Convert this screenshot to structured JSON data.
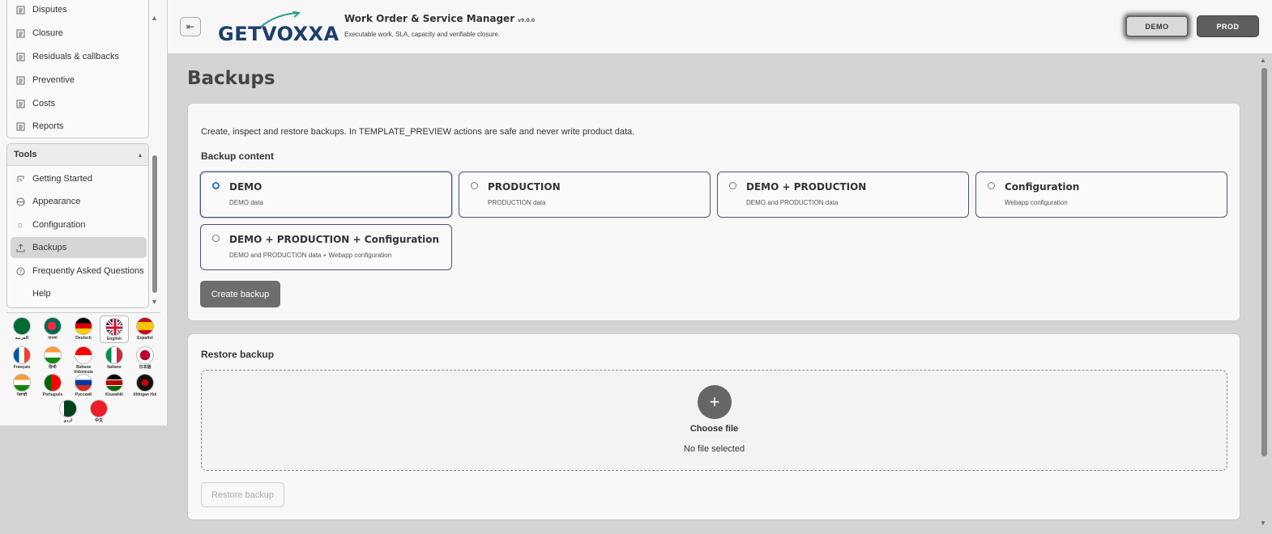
{
  "sidebar": {
    "top_items": [
      {
        "label": "Disputes"
      },
      {
        "label": "Closure"
      },
      {
        "label": "Residuals & callbacks"
      },
      {
        "label": "Preventive"
      },
      {
        "label": "Costs"
      },
      {
        "label": "Reports"
      }
    ],
    "tools_header": "Tools",
    "tools_items": [
      {
        "label": "Getting Started",
        "icon": "getting-started-icon"
      },
      {
        "label": "Appearance",
        "icon": "palette-icon"
      },
      {
        "label": "Configuration",
        "icon": "gear-icon"
      },
      {
        "label": "Backups",
        "icon": "upload-icon"
      },
      {
        "label": "Frequently Asked Questions",
        "icon": "question-icon"
      },
      {
        "label": "Help",
        "icon": "help-icon"
      }
    ],
    "languages": [
      {
        "name": "العربية"
      },
      {
        "name": "বাংলা"
      },
      {
        "name": "Deutsch"
      },
      {
        "name": "English"
      },
      {
        "name": "Español"
      },
      {
        "name": "Français"
      },
      {
        "name": "हिन्दी"
      },
      {
        "name": "Bahasa Indonesia"
      },
      {
        "name": "Italiano"
      },
      {
        "name": "日本語"
      },
      {
        "name": "ਪੰਜਾਬੀ"
      },
      {
        "name": "Português"
      },
      {
        "name": "Русский"
      },
      {
        "name": "Kiswahili"
      },
      {
        "name": "tlhIngan Hol"
      },
      {
        "name": "اردو"
      },
      {
        "name": "中文"
      }
    ]
  },
  "header": {
    "logo_text": "GETVOXXA",
    "title": "Work Order & Service Manager",
    "version": "v9.0.0",
    "subtitle": "Executable work, SLA, capacity and verifiable closure.",
    "env_demo": "DEMO",
    "env_prod": "PROD"
  },
  "main": {
    "page_title": "Backups",
    "intro": "Create, inspect and restore backups. In TEMPLATE_PREVIEW actions are safe and never write product data.",
    "backup_content_title": "Backup content",
    "options": [
      {
        "label": "DEMO",
        "desc": "DEMO data",
        "selected": true
      },
      {
        "label": "PRODUCTION",
        "desc": "PRODUCTION data",
        "selected": false
      },
      {
        "label": "DEMO + PRODUCTION",
        "desc": "DEMO and PRODUCTION data",
        "selected": false
      },
      {
        "label": "Configuration",
        "desc": "Webapp configuration",
        "selected": false
      },
      {
        "label": "DEMO + PRODUCTION + Configuration",
        "desc": "DEMO and PRODUCTION data + Webapp configuration",
        "selected": false
      }
    ],
    "create_button": "Create backup",
    "restore_title": "Restore backup",
    "choose_file": "Choose file",
    "no_file": "No file selected",
    "restore_button": "Restore backup"
  },
  "colors": {
    "accent_radio": "#2f6fd8",
    "logo_blue": "#1c3f6e",
    "button_dark": "#6e6e6e"
  }
}
